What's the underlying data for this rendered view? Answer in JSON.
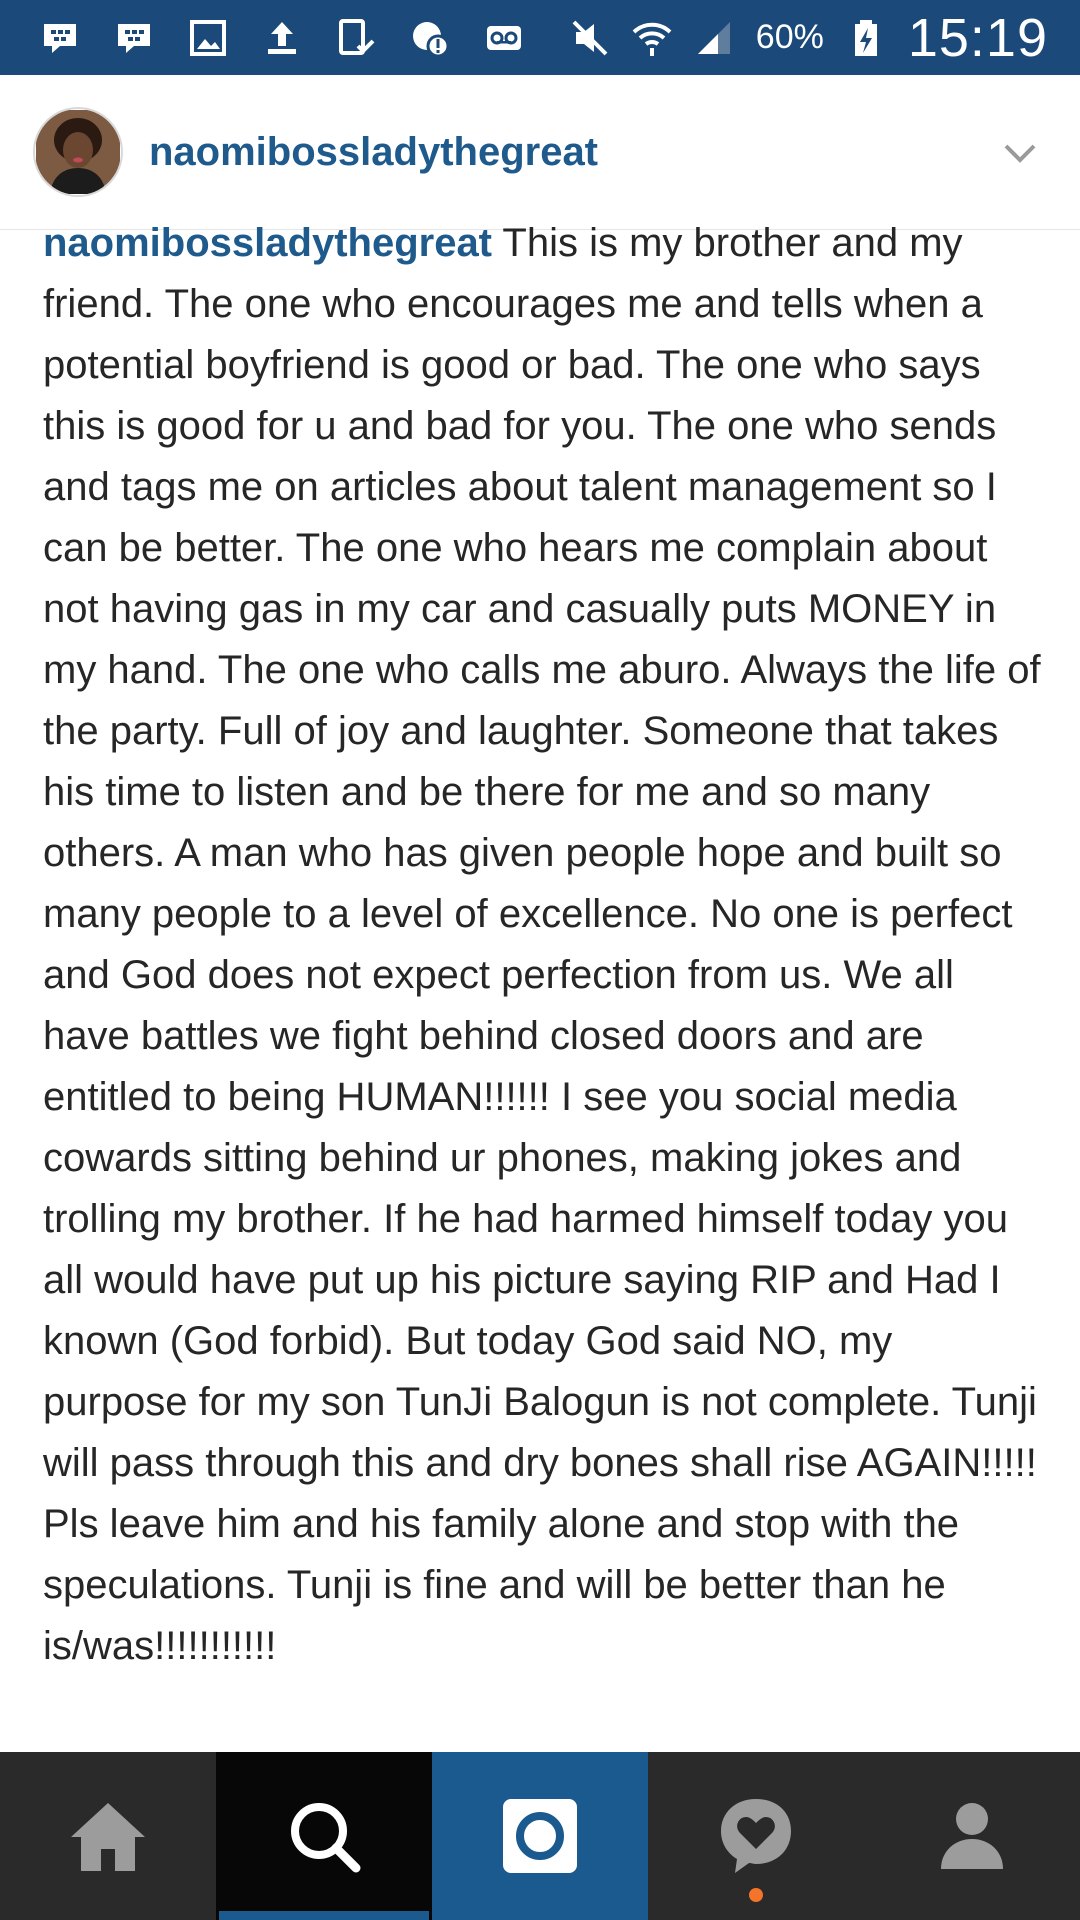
{
  "status_bar": {
    "battery_percent": "60%",
    "time": "15:19",
    "icons": [
      "bbm-icon",
      "bbm-icon",
      "gallery-icon",
      "upload-icon",
      "tablet-icon",
      "alert-icon",
      "voicemail-icon",
      "mute-icon",
      "wifi-icon",
      "signal-icon",
      "battery-charging-icon"
    ]
  },
  "header": {
    "username": "naomibossladythegreat",
    "avatar_icon": "avatar",
    "menu_icon": "chevron-down-icon"
  },
  "caption": {
    "username": "naomibossladythegreat",
    "text": "This is my brother and my friend. The one who encourages me and tells when a potential boyfriend is good or bad. The one who says this is good for u and bad for you. The one who sends and tags me on articles about talent management so I can be better. The one who hears me complain about not having gas in my car and casually puts MONEY in my hand. The one who calls me aburo. Always the life of the party. Full of joy and laughter. Someone that takes his time to listen and be there for me and so many others. A man who has given people hope and built so many people to a level of excellence. No one is perfect and God does not expect perfection from us. We all have battles we fight behind closed doors and are entitled to being HUMAN!!!!!! I see you social media cowards sitting behind ur phones, making jokes and trolling my brother. If he had harmed himself today you all would have put up his picture saying RIP and Had I known (God forbid). But today God said NO, my purpose for my son TunJi Balogun is not complete. Tunji will pass through this and dry bones shall rise AGAIN!!!!! Pls leave him and his family alone and stop with the speculations. Tunji is fine and will be better than he is/was!!!!!!!!!!!"
  },
  "bottom_nav": {
    "items": [
      {
        "name": "home",
        "icon": "home-icon",
        "active": false
      },
      {
        "name": "search",
        "icon": "search-icon",
        "active": true
      },
      {
        "name": "camera",
        "icon": "camera-icon",
        "active": false
      },
      {
        "name": "activity",
        "icon": "heart-bubble-icon",
        "active": false,
        "notification": true
      },
      {
        "name": "profile",
        "icon": "profile-icon",
        "active": false
      }
    ]
  },
  "colors": {
    "status_bar": "#1b4a7a",
    "brand_blue": "#1e5a8c",
    "camera_tab": "#1b5a8f",
    "nav_background": "#2a2a2a",
    "notification_dot": "#f4752a"
  }
}
